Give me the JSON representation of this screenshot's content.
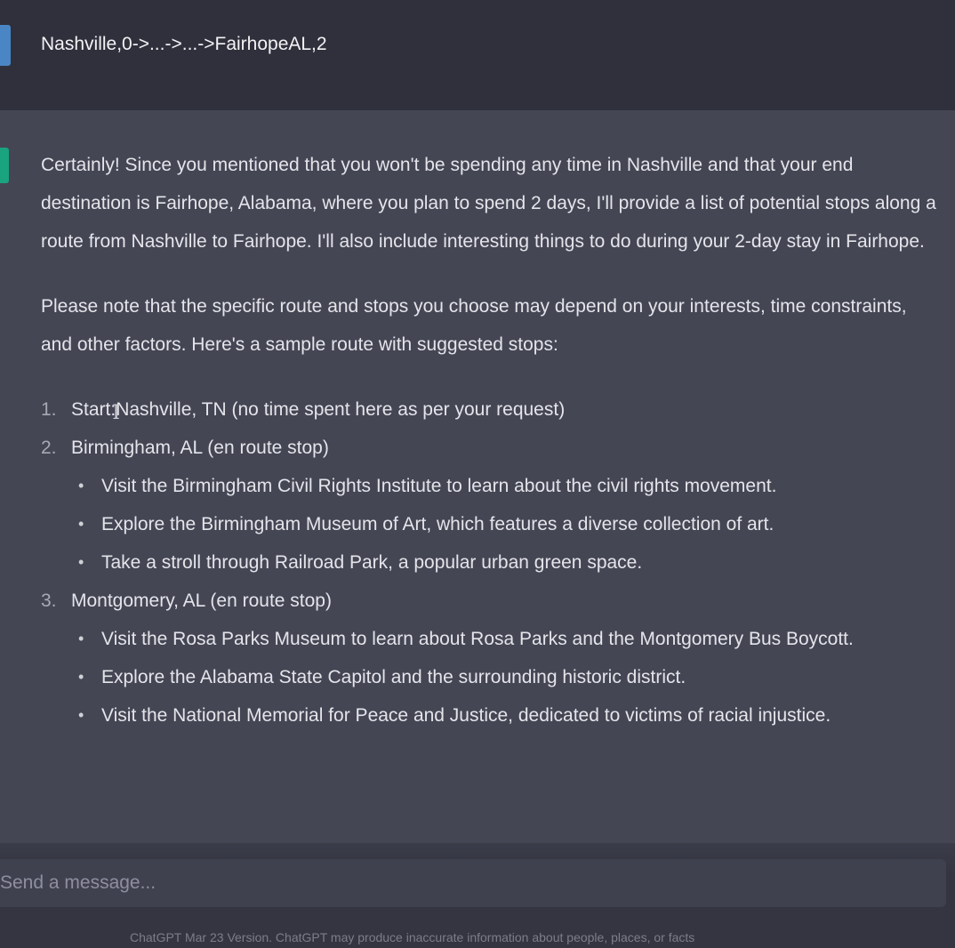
{
  "user_message": {
    "text": "Nashville,0->...->...->FairhopeAL,2"
  },
  "assistant_message": {
    "intro": "Certainly! Since you mentioned that you won't be spending any time in Nashville and that your end destination is Fairhope, Alabama, where you plan to spend 2 days, I'll provide a list of potential stops along a route from Nashville to Fairhope. I'll also include interesting things to do during your 2-day stay in Fairhope.",
    "note": "Please note that the specific route and stops you choose may depend on your interests, time constraints, and other factors. Here's a sample route with suggested stops:",
    "route": [
      {
        "num": "1.",
        "label_pre": "Start:",
        "label_post": "Nashville, TN (no time spent here as per your request)",
        "items": []
      },
      {
        "num": "2.",
        "label": "Birmingham, AL (en route stop)",
        "items": [
          "Visit the Birmingham Civil Rights Institute to learn about the civil rights movement.",
          "Explore the Birmingham Museum of Art, which features a diverse collection of art.",
          "Take a stroll through Railroad Park, a popular urban green space."
        ]
      },
      {
        "num": "3.",
        "label": "Montgomery, AL (en route stop)",
        "items": [
          "Visit the Rosa Parks Museum to learn about Rosa Parks and the Montgomery Bus Boycott.",
          "Explore the Alabama State Capitol and the surrounding historic district.",
          "Visit the National Memorial for Peace and Justice, dedicated to victims of racial injustice."
        ]
      }
    ]
  },
  "composer": {
    "placeholder": "Send a message...",
    "footer": "ChatGPT Mar 23 Version. ChatGPT may produce inaccurate information about people, places, or facts"
  },
  "colors": {
    "user_row_bg": "#2f303b",
    "assistant_row_bg": "#444654",
    "user_avatar": "#4a86c5",
    "assistant_avatar": "#19a37f",
    "input_bg": "#40414f"
  }
}
